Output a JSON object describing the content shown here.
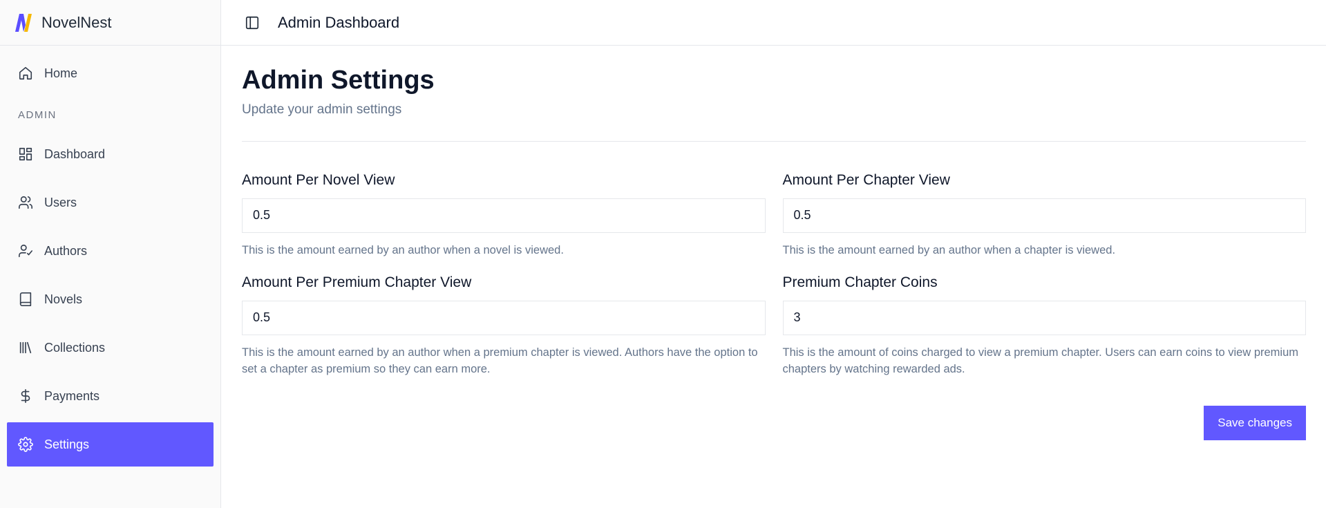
{
  "brand": {
    "name": "NovelNest"
  },
  "sidebar": {
    "home": {
      "label": "Home",
      "icon": "home-icon"
    },
    "section_label": "ADMIN",
    "items": [
      {
        "label": "Dashboard",
        "icon": "dashboard-icon"
      },
      {
        "label": "Users",
        "icon": "users-icon"
      },
      {
        "label": "Authors",
        "icon": "user-check-icon"
      },
      {
        "label": "Novels",
        "icon": "book-icon"
      },
      {
        "label": "Collections",
        "icon": "library-icon"
      },
      {
        "label": "Payments",
        "icon": "dollar-icon"
      },
      {
        "label": "Settings",
        "icon": "gear-icon",
        "active": true
      }
    ]
  },
  "header": {
    "title": "Admin Dashboard"
  },
  "page": {
    "title": "Admin Settings",
    "subtitle": "Update your admin settings"
  },
  "form": {
    "fields": [
      {
        "label": "Amount Per Novel View",
        "value": "0.5",
        "help": "This is the amount earned by an author when a novel is viewed."
      },
      {
        "label": "Amount Per Chapter View",
        "value": "0.5",
        "help": "This is the amount earned by an author when a chapter is viewed."
      },
      {
        "label": "Amount Per Premium Chapter View",
        "value": "0.5",
        "help": "This is the amount earned by an author when a premium chapter is viewed. Authors have the option to set a chapter as premium so they can earn more."
      },
      {
        "label": "Premium Chapter Coins",
        "value": "3",
        "help": "This is the amount of coins charged to view a premium chapter. Users can earn coins to view premium chapters by watching rewarded ads."
      }
    ],
    "save_label": "Save changes"
  },
  "colors": {
    "accent": "#6158ff",
    "logo_primary": "#5b4dff",
    "logo_secondary": "#f5b800"
  }
}
